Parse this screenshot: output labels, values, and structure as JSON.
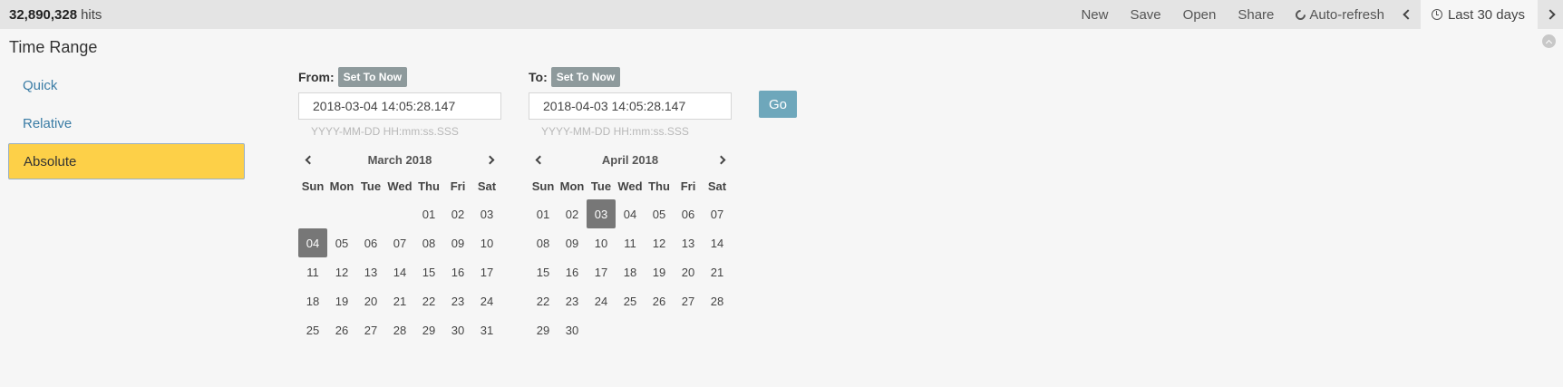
{
  "header": {
    "hits_count": "32,890,328",
    "hits_label": "hits",
    "menu": {
      "new": "New",
      "save": "Save",
      "open": "Open",
      "share": "Share",
      "auto_refresh": "Auto-refresh"
    },
    "range_label": "Last 30 days"
  },
  "panel": {
    "title": "Time Range",
    "modes": [
      "Quick",
      "Relative",
      "Absolute"
    ],
    "active_mode": "Absolute"
  },
  "from": {
    "label": "From:",
    "set_now": "Set To Now",
    "value": "2018-03-04 14:05:28.147",
    "format_hint": "YYYY-MM-DD HH:mm:ss.SSS",
    "calendar": {
      "month": "March 2018",
      "weekdays": [
        "Sun",
        "Mon",
        "Tue",
        "Wed",
        "Thu",
        "Fri",
        "Sat"
      ],
      "weeks": [
        [
          "",
          "",
          "",
          "",
          "01",
          "02",
          "03"
        ],
        [
          "04",
          "05",
          "06",
          "07",
          "08",
          "09",
          "10"
        ],
        [
          "11",
          "12",
          "13",
          "14",
          "15",
          "16",
          "17"
        ],
        [
          "18",
          "19",
          "20",
          "21",
          "22",
          "23",
          "24"
        ],
        [
          "25",
          "26",
          "27",
          "28",
          "29",
          "30",
          "31"
        ]
      ],
      "selected": "04"
    }
  },
  "to": {
    "label": "To:",
    "set_now": "Set To Now",
    "value": "2018-04-03 14:05:28.147",
    "format_hint": "YYYY-MM-DD HH:mm:ss.SSS",
    "calendar": {
      "month": "April 2018",
      "weekdays": [
        "Sun",
        "Mon",
        "Tue",
        "Wed",
        "Thu",
        "Fri",
        "Sat"
      ],
      "weeks": [
        [
          "01",
          "02",
          "03",
          "04",
          "05",
          "06",
          "07"
        ],
        [
          "08",
          "09",
          "10",
          "11",
          "12",
          "13",
          "14"
        ],
        [
          "15",
          "16",
          "17",
          "18",
          "19",
          "20",
          "21"
        ],
        [
          "22",
          "23",
          "24",
          "25",
          "26",
          "27",
          "28"
        ],
        [
          "29",
          "30",
          "",
          "",
          "",
          "",
          ""
        ]
      ],
      "selected": "03"
    }
  },
  "go_label": "Go",
  "colors": {
    "active_mode_bg": "#fdd048",
    "link": "#3a7ca5",
    "go_button": "#6ea7bb",
    "set_now_button": "#8e9a9c",
    "selected_day": "#777777"
  }
}
